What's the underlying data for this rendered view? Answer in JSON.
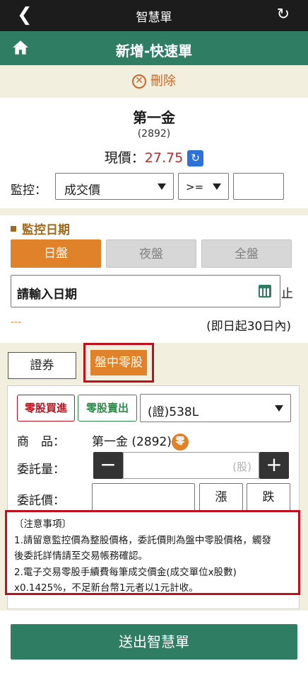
{
  "topbar": {
    "back_icon": "chevron-left-icon",
    "title": "智慧單",
    "refresh_icon": "refresh-icon"
  },
  "header": {
    "home_icon": "home-icon",
    "title": "新增-快速單"
  },
  "delete": {
    "label": "刪除"
  },
  "stock": {
    "name": "第一金",
    "code": "(2892)",
    "price_label": "現價：",
    "price": "27.75"
  },
  "monitor": {
    "label": "監控：",
    "field": "成交價",
    "operator": ">=",
    "value": ""
  },
  "date_section": {
    "title": "監控日期",
    "sessions": [
      "日盤",
      "夜盤",
      "全盤"
    ],
    "active_session": "日盤",
    "date_placeholder": "請輸入日期",
    "stop_char": "止",
    "dashes": "---",
    "within_note": "(即日起30日內)"
  },
  "order_tabs": {
    "securities": "證券",
    "intraday_odd": "盤中零股",
    "active": "盤中零股"
  },
  "order": {
    "buy_label": "零股買進",
    "sell_label": "零股賣出",
    "account": "(證)538L",
    "product_label": "商　品：",
    "product_value": "第一金 (2892)",
    "odd_badge": "零",
    "qty_label": "委託量：",
    "qty_placeholder": "(股)",
    "price_label": "委託價：",
    "up_label": "漲",
    "down_label": "跌"
  },
  "notes": {
    "title": "〔注意事項〕",
    "lines": [
      "1.請留意監控價為整股價格，委託價則為盤中零股價格，觸發",
      "後委託詳情請至交易帳務確認。",
      "2.電子交易零股手續費每筆成交價金(成交單位x股數)",
      "x0.1425%，不足新台幣1元者以1元計收。"
    ]
  },
  "submit": {
    "label": "送出智慧單"
  },
  "colors": {
    "green": "#2f7d62",
    "orange": "#e0822a",
    "red": "#c0101e",
    "beige": "#f3efdf"
  }
}
